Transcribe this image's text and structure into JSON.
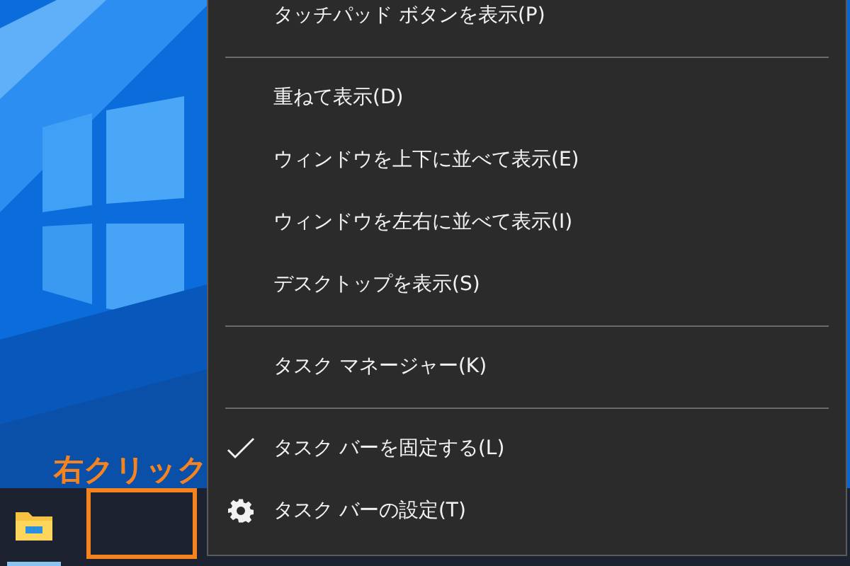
{
  "menu": {
    "items": [
      {
        "kind": "item",
        "label": "タッチパッド ボタンを表示(P)",
        "checked": false
      },
      {
        "kind": "separator"
      },
      {
        "kind": "item",
        "label": "重ねて表示(D)",
        "checked": false
      },
      {
        "kind": "item",
        "label": "ウィンドウを上下に並べて表示(E)",
        "checked": false
      },
      {
        "kind": "item",
        "label": "ウィンドウを左右に並べて表示(I)",
        "checked": false
      },
      {
        "kind": "item",
        "label": "デスクトップを表示(S)",
        "checked": false
      },
      {
        "kind": "separator"
      },
      {
        "kind": "item",
        "label": "タスク マネージャー(K)",
        "checked": false
      },
      {
        "kind": "separator"
      },
      {
        "kind": "item",
        "label": "タスク バーを固定する(L)",
        "checked": true
      },
      {
        "kind": "settings",
        "label": "タスク バーの設定(T)",
        "checked": false
      }
    ]
  },
  "annotation": {
    "label": "右クリック"
  },
  "taskbar": {
    "apps": [
      {
        "kind": "folder",
        "selected": true
      }
    ]
  }
}
